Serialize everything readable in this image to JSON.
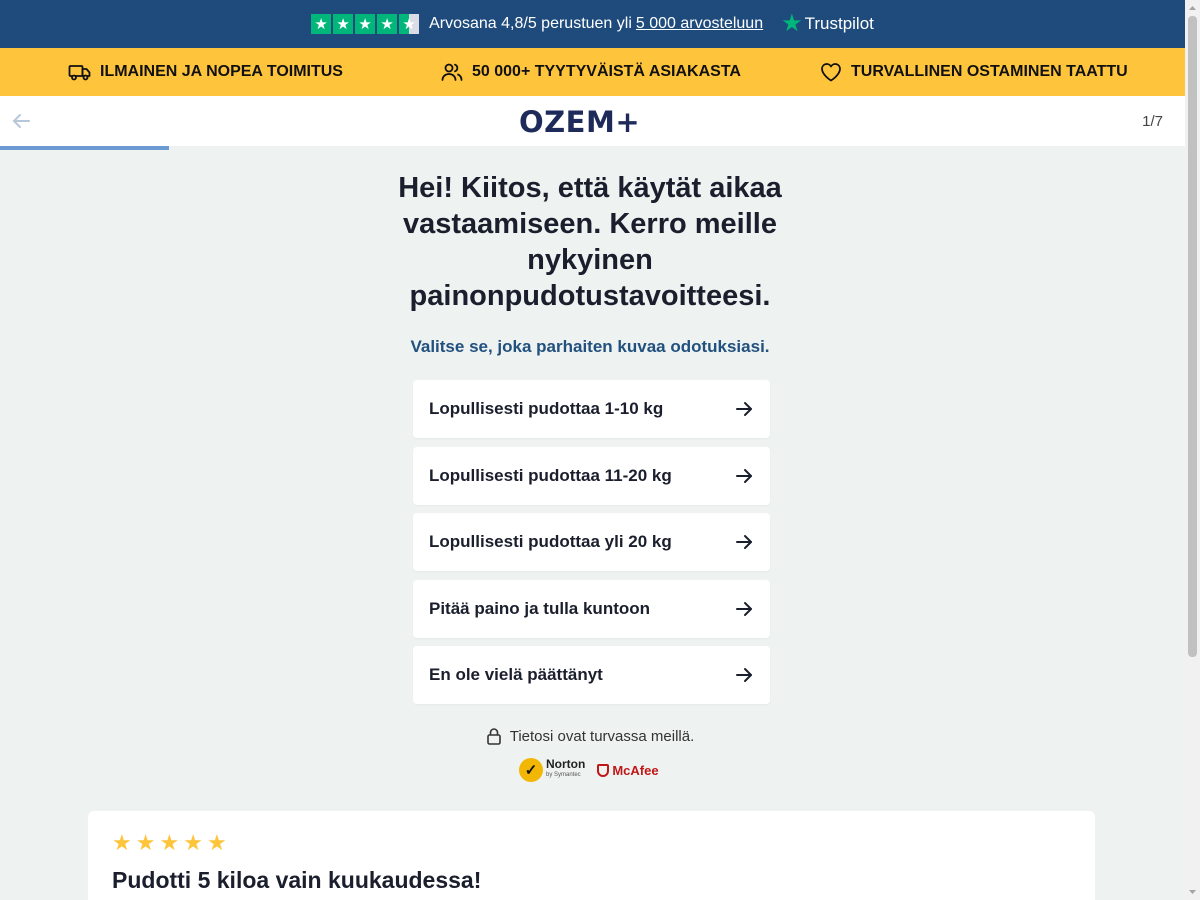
{
  "trustpilot": {
    "rating_text": "Arvosana 4,8/5 perustuen yli",
    "reviews_link": "5 000 arvosteluun",
    "brand": "Trustpilot"
  },
  "benefits": [
    {
      "icon": "truck-icon",
      "label": "ILMAINEN JA NOPEA TOIMITUS"
    },
    {
      "icon": "users-icon",
      "label": "50 000+ TYYTYVÄISTÄ ASIAKASTA"
    },
    {
      "icon": "heart-icon",
      "label": "TURVALLINEN OSTAMINEN TAATTU"
    }
  ],
  "header": {
    "logo": "OZEM+",
    "step": "1/7",
    "progress": 0.143
  },
  "quiz": {
    "question": "Hei! Kiitos, että käytät aikaa vastaamiseen. Kerro meille nykyinen painonpudotustavoitteesi.",
    "subtitle": "Valitse se, joka parhaiten kuvaa odotuksiasi.",
    "options": [
      "Lopullisesti pudottaa 1-10 kg",
      "Lopullisesti pudottaa 11-20 kg",
      "Lopullisesti pudottaa yli 20 kg",
      "Pitää paino ja tulla kuntoon",
      "En ole vielä päättänyt"
    ],
    "secure_note": "Tietosi ovat turvassa meillä."
  },
  "badges": {
    "norton": "Norton",
    "norton_sub": "by Symantec",
    "mcafee": "McAfee"
  },
  "review": {
    "rating": 5,
    "title": "Pudotti 5 kiloa vain kuukaudessa!"
  },
  "colors": {
    "navy": "#1e4b7c",
    "yellow": "#fec53c",
    "green": "#00b67a",
    "background": "#eef3f1"
  }
}
